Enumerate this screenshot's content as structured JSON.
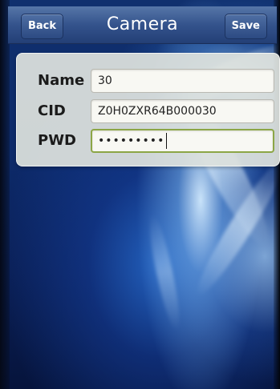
{
  "navbar": {
    "back_label": "Back",
    "title": "Camera",
    "save_label": "Save"
  },
  "form": {
    "name": {
      "label": "Name",
      "value": "30"
    },
    "cid": {
      "label": "CID",
      "value": "Z0H0ZXR64B000030"
    },
    "pwd": {
      "label": "PWD",
      "value": "•••••••••"
    }
  },
  "colors": {
    "navbar": "#34538c",
    "panel": "#dee2de",
    "focus_border": "#8ca646"
  }
}
